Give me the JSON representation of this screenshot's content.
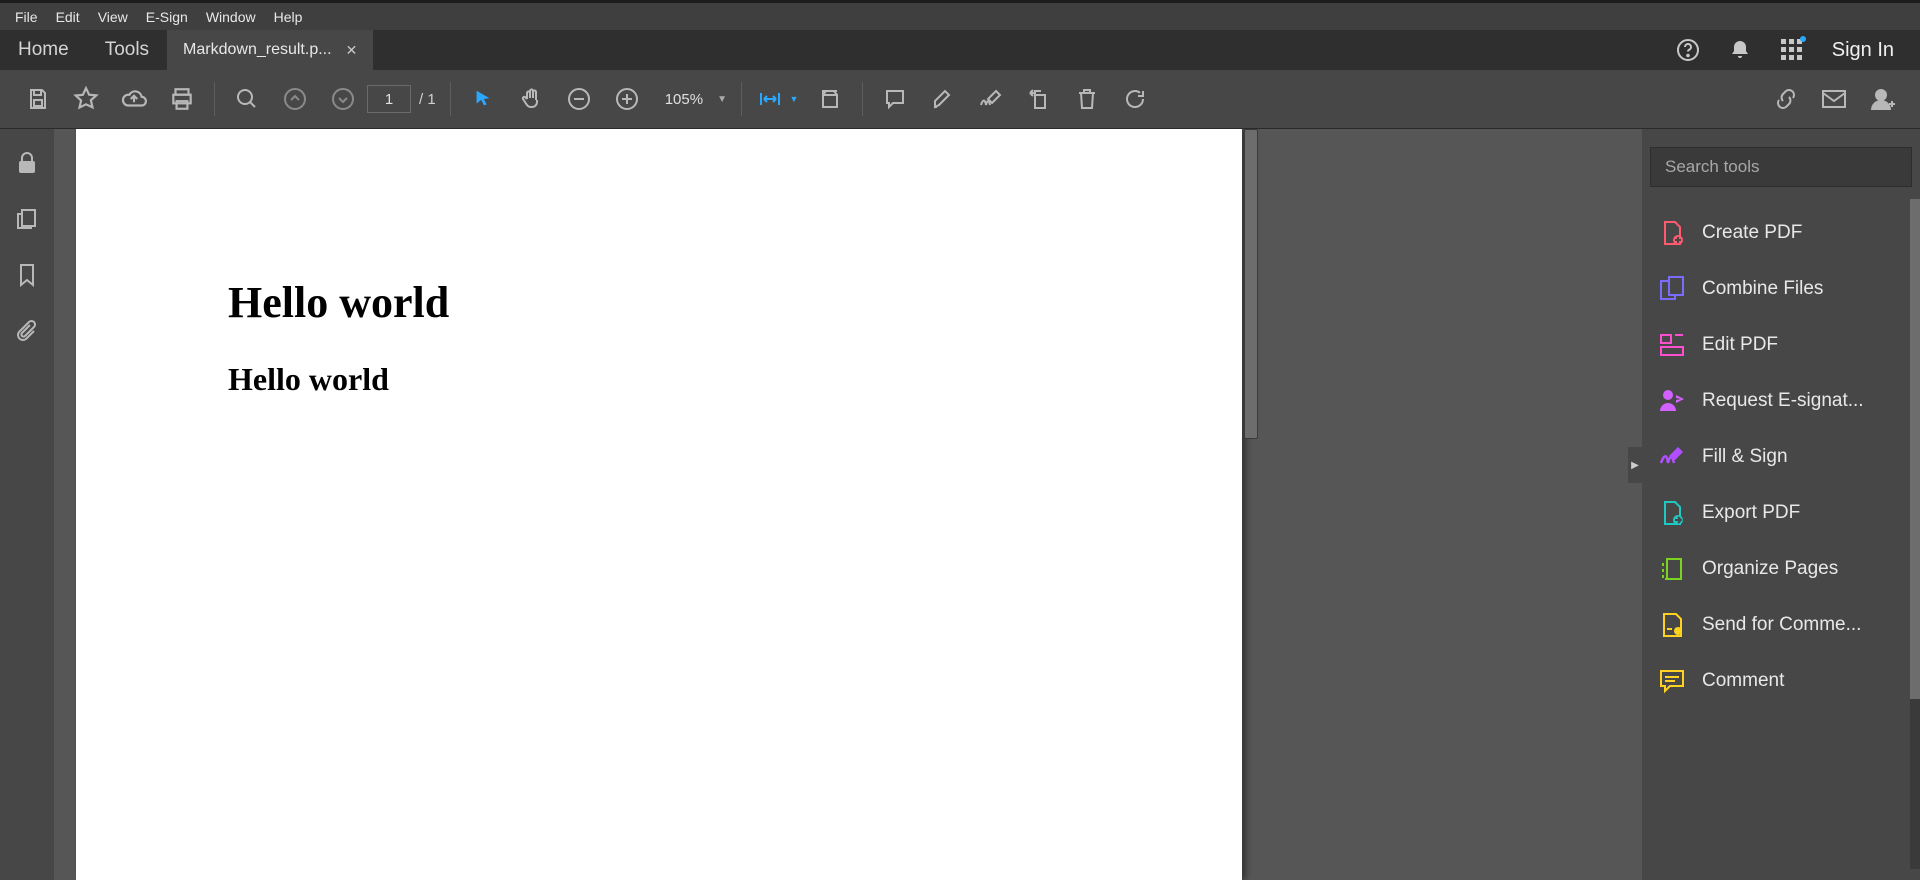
{
  "menubar": {
    "items": [
      "File",
      "Edit",
      "View",
      "E-Sign",
      "Window",
      "Help"
    ]
  },
  "tabs": {
    "home": "Home",
    "tools": "Tools",
    "document_title": "Markdown_result.p...",
    "sign_in": "Sign In"
  },
  "toolbar": {
    "page_current": "1",
    "page_total": "/  1",
    "zoom": "105%"
  },
  "document": {
    "heading1": "Hello world",
    "heading2": "Hello world"
  },
  "right_panel": {
    "search_placeholder": "Search tools",
    "tools": [
      {
        "label": "Create PDF",
        "color": "#ff5a6e"
      },
      {
        "label": "Combine Files",
        "color": "#7a6cff"
      },
      {
        "label": "Edit PDF",
        "color": "#ff4fd1"
      },
      {
        "label": "Request E-signat...",
        "color": "#d262ff"
      },
      {
        "label": "Fill & Sign",
        "color": "#b14fff"
      },
      {
        "label": "Export PDF",
        "color": "#1fc9c3"
      },
      {
        "label": "Organize Pages",
        "color": "#7ad41f"
      },
      {
        "label": "Send for Comme...",
        "color": "#ffd21f"
      },
      {
        "label": "Comment",
        "color": "#ffd21f"
      }
    ]
  }
}
